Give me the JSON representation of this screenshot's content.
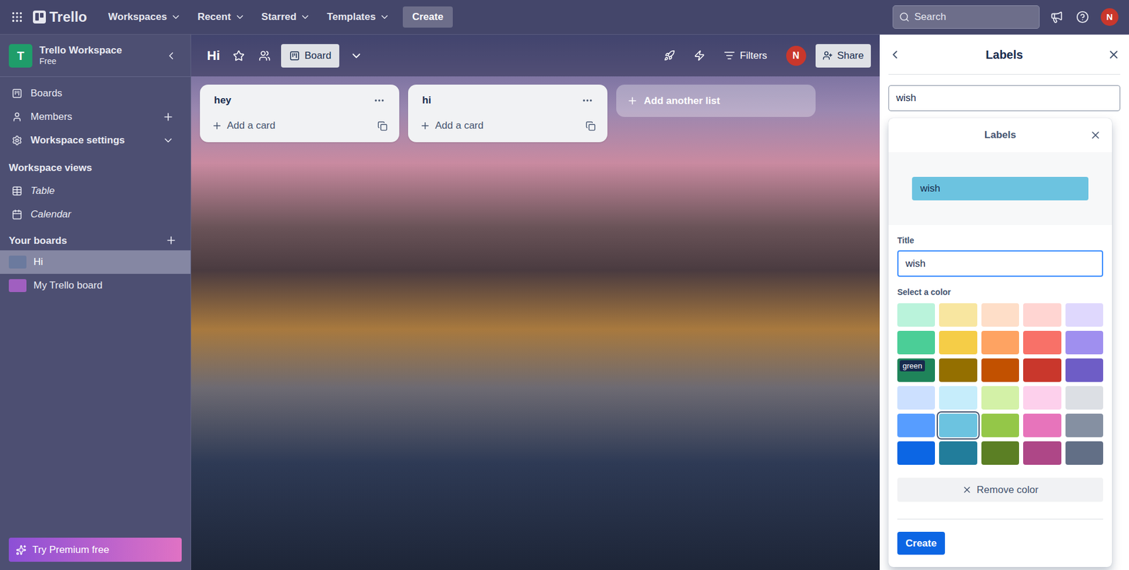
{
  "topbar": {
    "brand": "Trello",
    "menus": [
      {
        "label": "Workspaces"
      },
      {
        "label": "Recent"
      },
      {
        "label": "Starred"
      },
      {
        "label": "Templates"
      }
    ],
    "create": "Create",
    "search": {
      "placeholder": "Search"
    },
    "avatar": "N"
  },
  "workspace": {
    "initial": "T",
    "name": "Trello Workspace",
    "plan": "Free"
  },
  "sidebar": {
    "items": [
      {
        "label": "Boards",
        "kind": "link"
      },
      {
        "label": "Members",
        "kind": "add"
      },
      {
        "label": "Workspace settings",
        "kind": "expand"
      }
    ],
    "views_title": "Workspace views",
    "views": [
      {
        "label": "Table"
      },
      {
        "label": "Calendar"
      }
    ],
    "boards_title": "Your boards",
    "boards": [
      {
        "name": "Hi",
        "selected": true,
        "color": "#6b7a9e"
      },
      {
        "name": "My Trello board",
        "selected": false,
        "color": "#a05fc0"
      }
    ],
    "premium": "Try Premium free"
  },
  "board": {
    "title": "Hi",
    "view": "Board",
    "filters": "Filters",
    "avatar": "N",
    "share": "Share",
    "lists": [
      {
        "title": "hey",
        "add": "Add a card"
      },
      {
        "title": "hi",
        "add": "Add a card"
      }
    ],
    "add_list": "Add another list"
  },
  "labels_panel": {
    "title": "Labels",
    "search": "wish"
  },
  "popup": {
    "title": "Labels",
    "preview": "wish",
    "preview_color": "#6cc3e0",
    "field_label": "Title",
    "field_value": "wish",
    "color_label": "Select a color",
    "tooltip": "green",
    "colors": [
      {
        "color": "#baf3db",
        "selected": false,
        "hovered": false
      },
      {
        "color": "#f8e6a0",
        "selected": false,
        "hovered": false
      },
      {
        "color": "#fedec8",
        "selected": false,
        "hovered": false
      },
      {
        "color": "#ffd5d2",
        "selected": false,
        "hovered": false
      },
      {
        "color": "#dfd8fd",
        "selected": false,
        "hovered": false
      },
      {
        "color": "#4bce97",
        "selected": false,
        "hovered": false
      },
      {
        "color": "#f5cd47",
        "selected": false,
        "hovered": false
      },
      {
        "color": "#fea362",
        "selected": false,
        "hovered": false
      },
      {
        "color": "#f87168",
        "selected": false,
        "hovered": false
      },
      {
        "color": "#9f8fef",
        "selected": false,
        "hovered": false
      },
      {
        "color": "#1f845a",
        "selected": false,
        "hovered": true
      },
      {
        "color": "#946f00",
        "selected": false,
        "hovered": false
      },
      {
        "color": "#c25100",
        "selected": false,
        "hovered": false
      },
      {
        "color": "#c9372c",
        "selected": false,
        "hovered": false
      },
      {
        "color": "#6e5dc6",
        "selected": false,
        "hovered": false
      },
      {
        "color": "#cce0ff",
        "selected": false,
        "hovered": false
      },
      {
        "color": "#c6edfb",
        "selected": false,
        "hovered": false
      },
      {
        "color": "#d3f1a7",
        "selected": false,
        "hovered": false
      },
      {
        "color": "#fdd0ec",
        "selected": false,
        "hovered": false
      },
      {
        "color": "#dcdfe4",
        "selected": false,
        "hovered": false
      },
      {
        "color": "#579dff",
        "selected": false,
        "hovered": false
      },
      {
        "color": "#6cc3e0",
        "selected": true,
        "hovered": false
      },
      {
        "color": "#94c748",
        "selected": false,
        "hovered": false
      },
      {
        "color": "#e774bb",
        "selected": false,
        "hovered": false
      },
      {
        "color": "#8590a2",
        "selected": false,
        "hovered": false
      },
      {
        "color": "#0c66e4",
        "selected": false,
        "hovered": false
      },
      {
        "color": "#227d9b",
        "selected": false,
        "hovered": false
      },
      {
        "color": "#5b7f24",
        "selected": false,
        "hovered": false
      },
      {
        "color": "#ae4787",
        "selected": false,
        "hovered": false
      },
      {
        "color": "#626f86",
        "selected": false,
        "hovered": false
      }
    ],
    "remove": "Remove color",
    "create": "Create"
  }
}
